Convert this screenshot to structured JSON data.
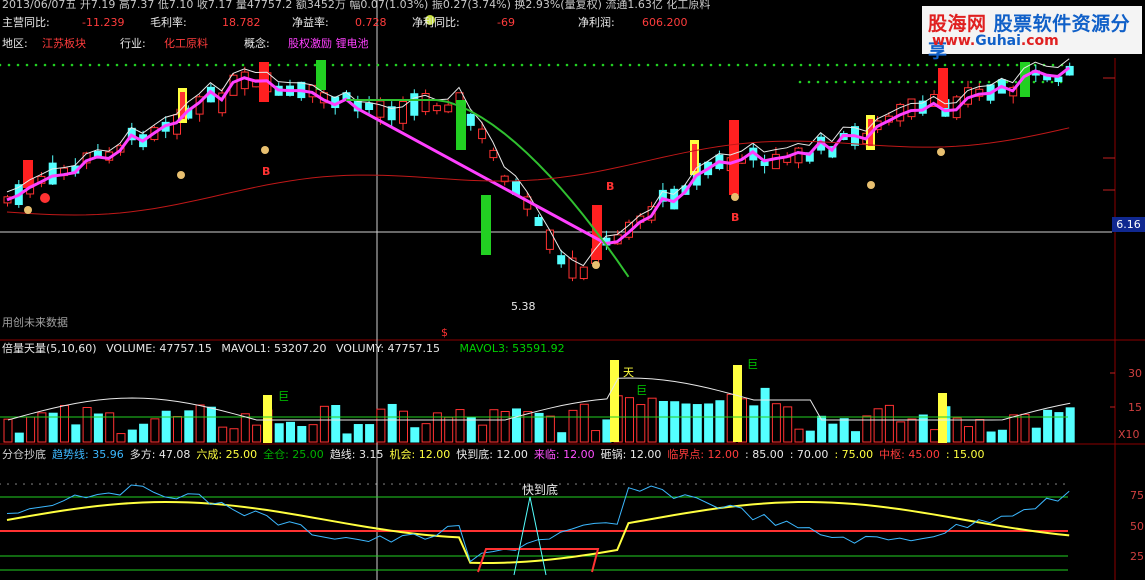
{
  "quote_bar": "2013/06/07五 开7.19 高7.37 低7.10 收7.17 量47757.2 额3452万 幅0.07(1.03%) 振0.27(3.74%) 换2.93%(量复权) 流通1.63亿 化工原料",
  "fundamentals": {
    "rev_growth": {
      "label": "主营同比:",
      "value": "-11.239"
    },
    "gross_margin": {
      "label": "毛利率:",
      "value": "18.782"
    },
    "roe": {
      "label": "净益率:",
      "value": "0.728"
    },
    "profit_growth": {
      "label": "净利同比:",
      "value": "-69"
    },
    "net_profit": {
      "label": "净利润:",
      "value": "606.200"
    }
  },
  "profile": {
    "region_label": "地区:",
    "region": "江苏板块",
    "industry_label": "行业:",
    "industry": "化工原料",
    "concept_label": "概念:",
    "concepts": "股权激励 锂电池"
  },
  "logo": {
    "part1": "股海网",
    "part2": "股票软件资源分享",
    "url1": "www.",
    "url2": "Guhai",
    "url3": ".com"
  },
  "price_tag": "6.16",
  "low_annotation": "5.38",
  "future_data_note": "用创未来数据",
  "buy_marker": "B",
  "dollar_marker": "$",
  "volume_header": {
    "title": "倍量天量(5,10,60)",
    "volume": "VOLUME: 47757.15",
    "mavol1": "MAVOL1: 53207.20",
    "volumy": "VOLUMY: 47757.15",
    "mavol3": "MAVOL3: 53591.92"
  },
  "volume_marks": {
    "tian": "天",
    "ju": "巨"
  },
  "volume_axis": [
    "30",
    "15",
    "X10"
  ],
  "indicator_header": [
    {
      "text": "分仓抄底",
      "color": "#d0d0d0"
    },
    {
      "text": "趋势线: 35.96",
      "color": "#3cb8ff"
    },
    {
      "text": "多方: 47.08",
      "color": "#e8e8e8"
    },
    {
      "text": "六成: 25.00",
      "color": "#ffff40"
    },
    {
      "text": "全仓: 25.00",
      "color": "#00b000"
    },
    {
      "text": "趋线: 3.15",
      "color": "#e8e8e8"
    },
    {
      "text": "机会: 12.00",
      "color": "#ffff40"
    },
    {
      "text": "快到底: 12.00",
      "color": "#e8e8e8"
    },
    {
      "text": "来临: 12.00",
      "color": "#ff50ff"
    },
    {
      "text": "砸锅: 12.00",
      "color": "#e8e8e8"
    },
    {
      "text": "临界点: 12.00",
      "color": "#ff3c3c"
    },
    {
      "text": ": 85.00",
      "color": "#e8e8e8"
    },
    {
      "text": ": 70.00",
      "color": "#e8e8e8"
    },
    {
      "text": ": 75.00",
      "color": "#ffff40"
    },
    {
      "text": "中枢: 45.00",
      "color": "#ff3c3c"
    },
    {
      "text": ": 15.00",
      "color": "#ffff40"
    }
  ],
  "indicator_axis": [
    "75",
    "50",
    "25"
  ],
  "fast_bottom_label": "快到底",
  "colors": {
    "up": "#ff3232",
    "down": "#54ffff",
    "ma5": "#e8e8e8",
    "ma10": "#ff40ff",
    "ma20": "#30c030",
    "ma60": "#c01818",
    "grid": "#8b0000",
    "yellow": "#ffff40"
  }
}
